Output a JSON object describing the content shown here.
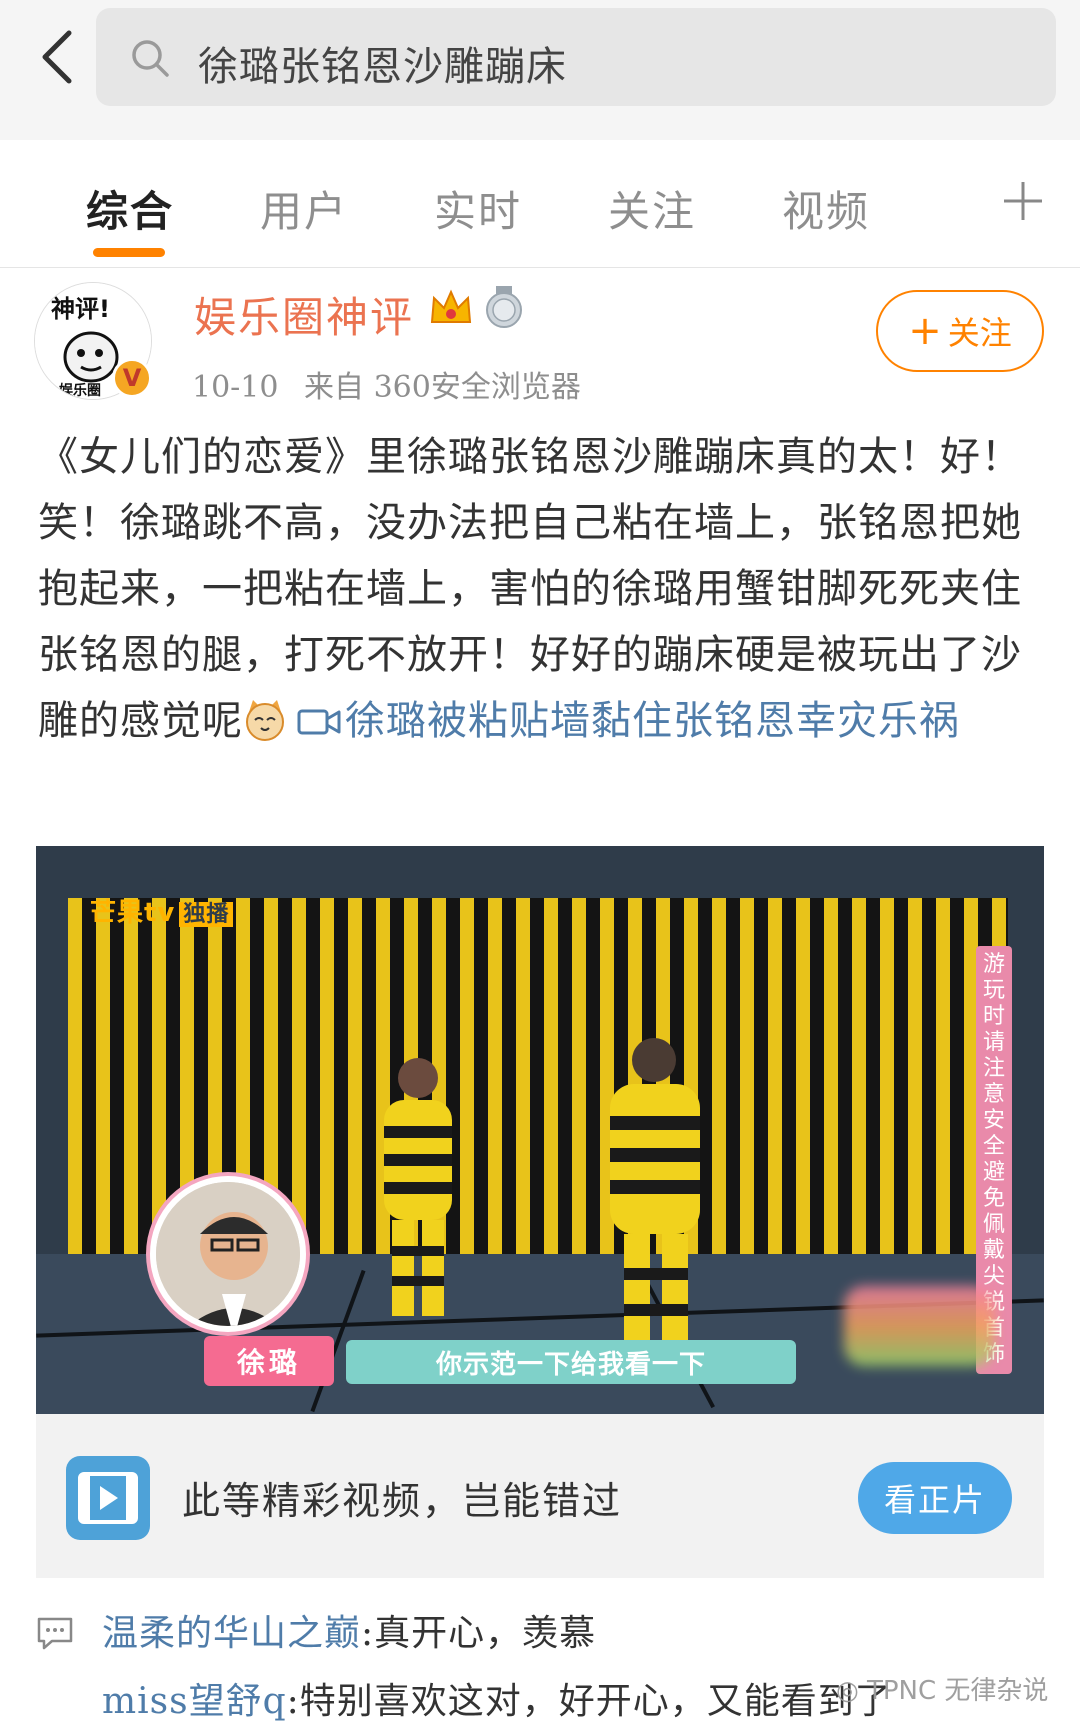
{
  "search": {
    "query": "徐璐张铭恩沙雕蹦床"
  },
  "tabs": [
    {
      "label": "综合",
      "active": true
    },
    {
      "label": "用户",
      "active": false
    },
    {
      "label": "实时",
      "active": false
    },
    {
      "label": "关注",
      "active": false
    },
    {
      "label": "视频",
      "active": false
    }
  ],
  "post": {
    "author": "娱乐圈神评",
    "avatar_text": "神评!",
    "avatar_sub": "娱乐圈",
    "verified_badge": "V",
    "date": "10-10",
    "source": "来自 360安全浏览器",
    "follow_label": "关注",
    "body": "《女儿们的恋爱》里徐璐张铭恩沙雕蹦床真的太！好！笑！徐璐跳不高，没办法把自己粘在墙上，张铭恩把她抱起来，一把粘在墙上，害怕的徐璐用蟹钳脚死死夹住张铭恩的腿，打死不放开！好好的蹦床硬是被玩出了沙雕的感觉呢",
    "video_link": "徐璐被粘贴墙黏住张铭恩幸灾乐祸"
  },
  "video": {
    "logo": "芒果tv",
    "logo_badge": "独播",
    "side_note": "游玩时请注意安全避免佩戴尖锐首饰",
    "name_tag": "徐璐",
    "subtitle": "你示范一下给我看一下",
    "footer_text": "此等精彩视频，岂能错过",
    "footer_button": "看正片"
  },
  "comments": [
    {
      "user": "温柔的华山之巅",
      "text": ":真开心，羡慕"
    },
    {
      "user": "miss望舒q",
      "text": ":特别喜欢这对，好开心，又能看到了"
    }
  ],
  "watermark": "TPNC 无律杂说",
  "colors": {
    "accent": "#ff8200",
    "author": "#eb7350",
    "link": "#4f7ca9",
    "button_blue": "#4fa8e8"
  }
}
